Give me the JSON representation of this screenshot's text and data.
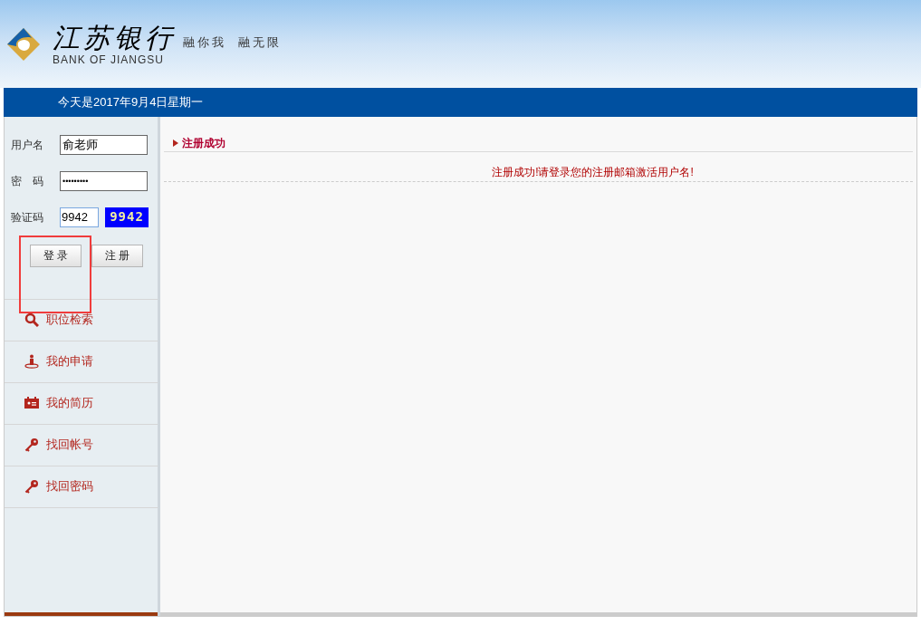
{
  "header": {
    "logo_cn": "江苏银行",
    "logo_en": "BANK OF JIANGSU",
    "slogan": "融你我  融无限"
  },
  "date_bar": "今天是2017年9月4日星期一",
  "login": {
    "fields": [
      {
        "label": "用户名",
        "value": "俞老师",
        "kind": "text"
      },
      {
        "label": "密　码",
        "value": "•••••••••",
        "kind": "password"
      },
      {
        "label": "验证码",
        "value": "9942",
        "kind": "captcha",
        "captcha": "9942"
      }
    ],
    "buttons": [
      {
        "label": "登 录",
        "highlighted": true
      },
      {
        "label": "注 册",
        "highlighted": false
      }
    ]
  },
  "nav": [
    {
      "label": "职位检索",
      "kind": "search"
    },
    {
      "label": "我的申请",
      "kind": "person"
    },
    {
      "label": "我的简历",
      "kind": "card"
    },
    {
      "label": "找回帐号",
      "kind": "key"
    },
    {
      "label": "找回密码",
      "kind": "key"
    }
  ],
  "content": {
    "title": "注册成功",
    "message": "注册成功!请登录您的注册邮箱激活用户名!"
  }
}
